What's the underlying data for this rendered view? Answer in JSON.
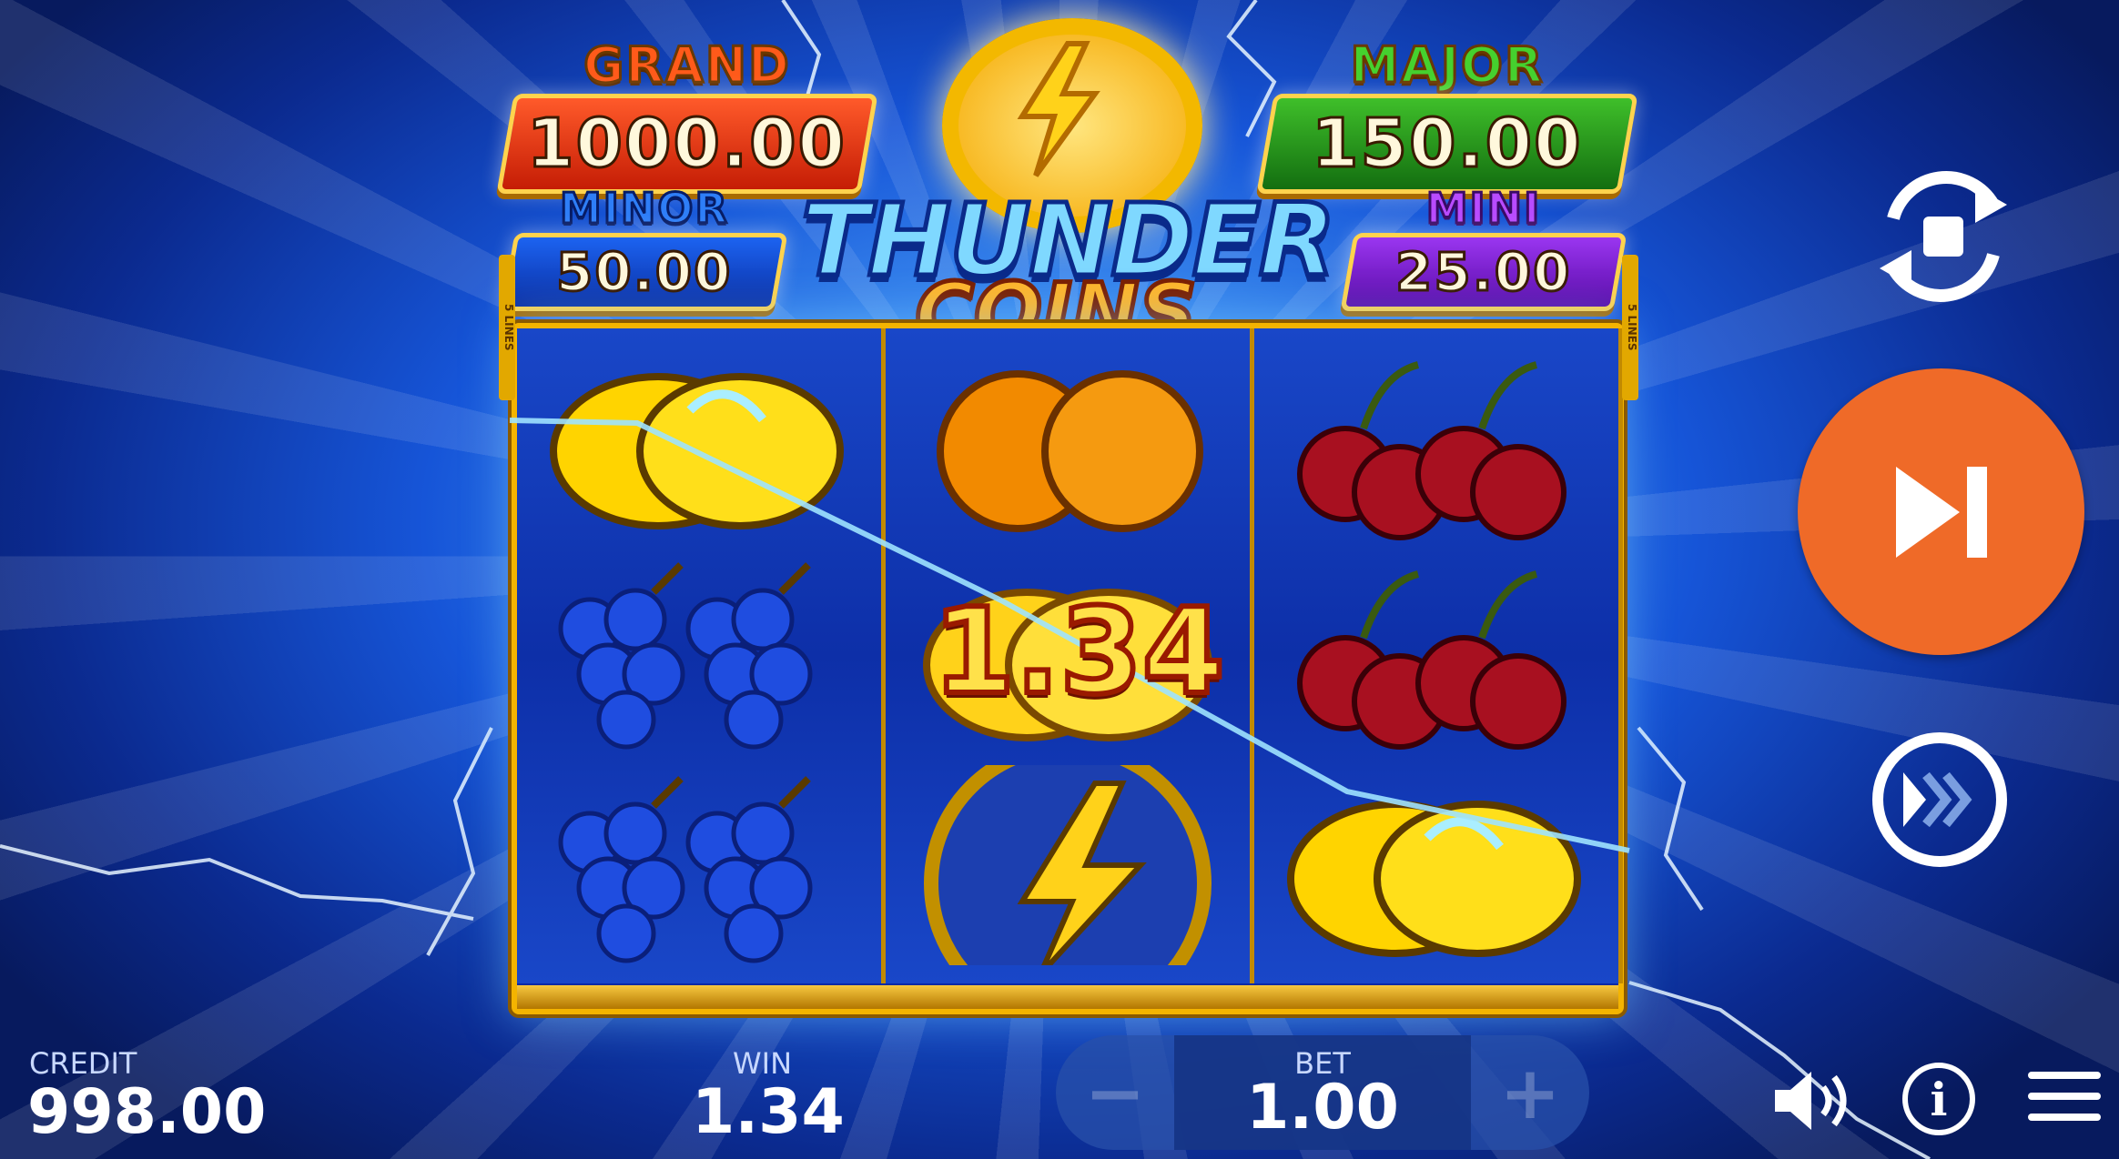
{
  "jackpots": {
    "grand": {
      "label": "GRAND",
      "value": "1000.00"
    },
    "major": {
      "label": "MAJOR",
      "value": "150.00"
    },
    "minor": {
      "label": "MINOR",
      "value": "50.00"
    },
    "mini": {
      "label": "MINI",
      "value": "25.00"
    }
  },
  "logo": {
    "line1": "THUNDER",
    "line2": "COINS"
  },
  "reels": {
    "lines_tag": "5 LINES",
    "columns": [
      [
        "lemon",
        "grapes",
        "grapes"
      ],
      [
        "orange",
        "coin",
        "thunder-coin"
      ],
      [
        "cherry",
        "cherry",
        "lemon"
      ]
    ],
    "coin_value": "1.34"
  },
  "bottom_bar": {
    "credit_label": "CREDIT",
    "credit_value": "998.00",
    "win_label": "WIN",
    "win_value": "1.34",
    "bet_label": "BET",
    "bet_value": "1.00",
    "minus": "−",
    "plus": "+"
  },
  "controls": {
    "autoplay_icon": "autoplay-stop-icon",
    "spin_icon": "skip-forward-icon",
    "turbo_icon": "fast-forward-icon",
    "sound_icon": "speaker-icon",
    "info_icon": "info-icon",
    "menu_icon": "hamburger-menu-icon",
    "info_glyph": "i"
  },
  "colors": {
    "spin_button": "#ef6a28",
    "grand": "#ff5a1a",
    "major": "#45d12e",
    "minor": "#2e7ef7",
    "mini": "#b84bff"
  }
}
